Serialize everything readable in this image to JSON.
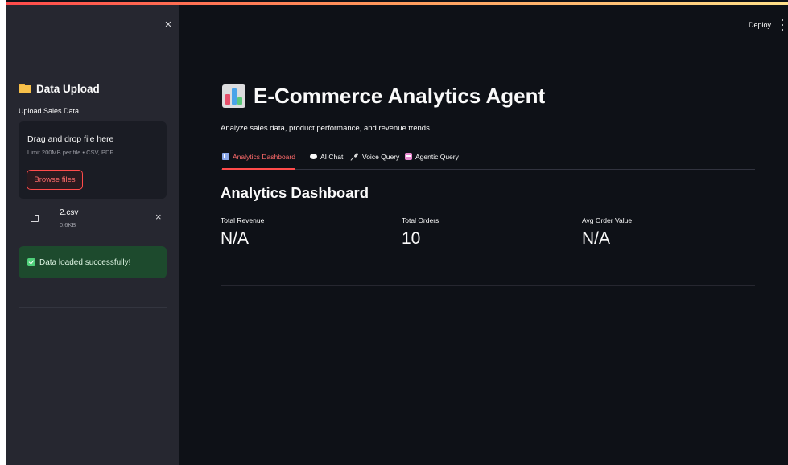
{
  "header": {
    "deploy_label": "Deploy"
  },
  "sidebar": {
    "close_glyph": "×",
    "title": "Data Upload",
    "title_icon": "folder-icon",
    "upload_label": "Upload Sales Data",
    "dropzone": {
      "title": "Drag and drop file here",
      "limit": "Limit 200MB per file • CSV, PDF",
      "browse_label": "Browse files"
    },
    "file": {
      "name": "2.csv",
      "size": "0.6KB",
      "remove_glyph": "×"
    },
    "success_message": "Data loaded successfully!"
  },
  "main": {
    "title": "E-Commerce Analytics Agent",
    "title_icon": "bar-chart-icon",
    "subtitle": "Analyze sales data, product performance, and revenue trends",
    "tabs": [
      {
        "label": "Analytics Dashboard",
        "icon": "chart-icon",
        "active": true
      },
      {
        "label": "AI Chat",
        "icon": "speech-bubble-icon",
        "active": false
      },
      {
        "label": "Voice Query",
        "icon": "microphone-icon",
        "active": false
      },
      {
        "label": "Agentic Query",
        "icon": "robot-icon",
        "active": false
      }
    ],
    "section_title": "Analytics Dashboard",
    "metrics": [
      {
        "label": "Total Revenue",
        "value": "N/A"
      },
      {
        "label": "Total Orders",
        "value": "10"
      },
      {
        "label": "Avg Order Value",
        "value": "N/A"
      }
    ]
  },
  "colors": {
    "background": "#0e1117",
    "sidebar": "#262730",
    "accent": "#ff4b4b",
    "success_bg": "#1d4a2d"
  }
}
